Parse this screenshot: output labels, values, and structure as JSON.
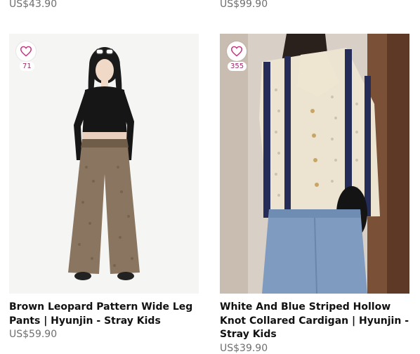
{
  "top_prices": {
    "left": "US$43.90",
    "right": "US$99.90"
  },
  "products": [
    {
      "wishlist_count": "71",
      "title": "Brown Leopard Pattern Wide Leg Pants | Hyunjin - Stray Kids",
      "price": "US$59.90",
      "image_icon": "product-photo-leopard-pants"
    },
    {
      "wishlist_count": "355",
      "title": "White And Blue Striped Hollow Knot Collared Cardigan | Hyunjin - Stray Kids",
      "price": "US$39.90",
      "image_icon": "product-photo-striped-cardigan"
    }
  ],
  "colors": {
    "heart": "#c2357e",
    "price": "#6f6f6f"
  }
}
